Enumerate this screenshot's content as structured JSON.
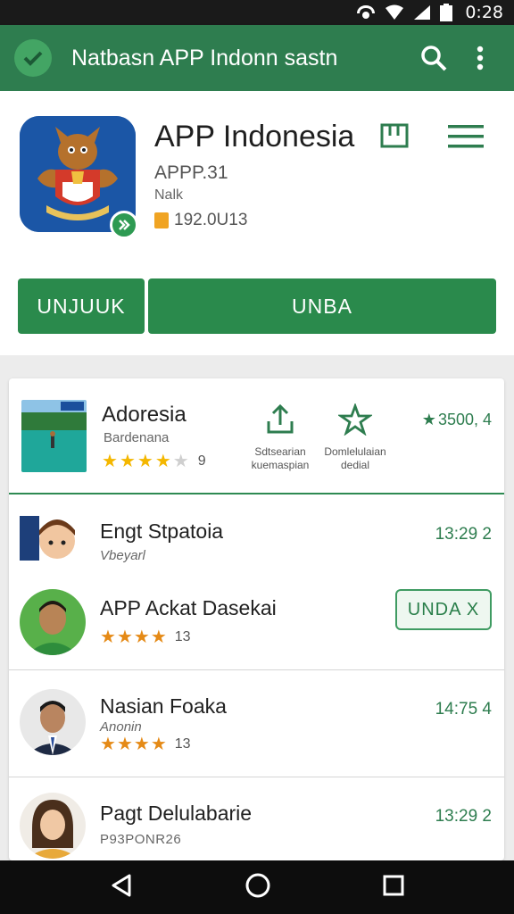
{
  "status_bar": {
    "time": "0:28"
  },
  "app_bar": {
    "title": "Natbasn APP Indonn sastn"
  },
  "app": {
    "name": "APP Indonesia",
    "version": "APPP.31",
    "developer": "Nalk",
    "size": "192.0U13",
    "buttons": {
      "left": "UNJUUK",
      "right": "UNBA"
    }
  },
  "featured": {
    "title": "Adoresia",
    "subtitle": "Bardenana",
    "rating": 4,
    "rating_label": "9",
    "action1": "Sdtsearian kuemaspian",
    "action2": "Domlelulaian dedial",
    "price": "3500, 4"
  },
  "items": [
    {
      "name": "Engt Stpatoia",
      "sub": "Vbeyarl",
      "meta": "13:29 2"
    },
    {
      "name": "APP Ackat Dasekai",
      "rating": 4,
      "rating_label": "13",
      "button": "UNDA X"
    },
    {
      "name": "Nasian Foaka",
      "sub": "Anonin",
      "rating": 3.5,
      "rating_label": "13",
      "meta": "14:75 4"
    },
    {
      "name": "Pagt Delulabarie",
      "sub": "P93PONR26",
      "meta": "13:29 2"
    }
  ],
  "colors": {
    "primary": "#2e7d4f",
    "button": "#2a8a4c",
    "star": "#f4b700",
    "star_orange": "#e58a16"
  }
}
